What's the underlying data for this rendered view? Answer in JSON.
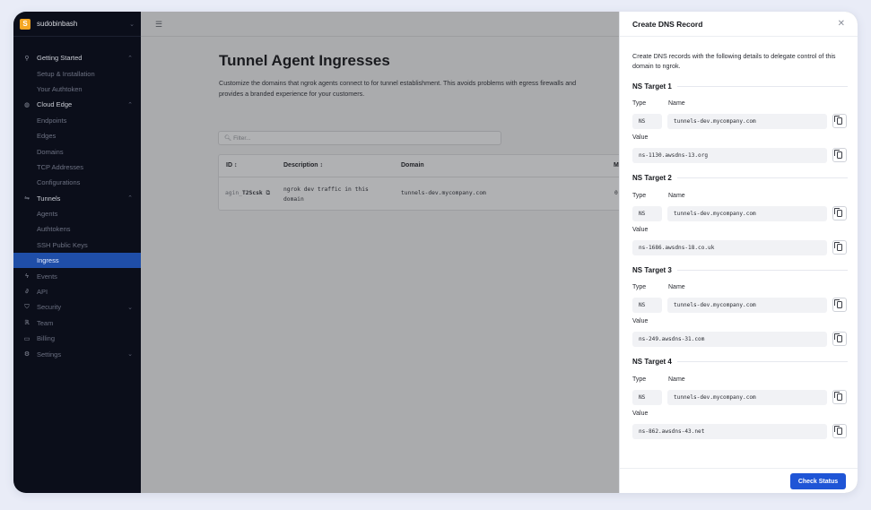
{
  "sidebar": {
    "org_initial": "S",
    "org_name": "sudobinbash",
    "items": [
      {
        "label": "Getting Started",
        "icon": "rocket-icon",
        "kind": "group"
      },
      {
        "label": "Setup & Installation",
        "kind": "sub"
      },
      {
        "label": "Your Authtoken",
        "kind": "sub"
      },
      {
        "label": "Cloud Edge",
        "icon": "globe-icon",
        "kind": "group"
      },
      {
        "label": "Endpoints",
        "kind": "sub"
      },
      {
        "label": "Edges",
        "kind": "sub"
      },
      {
        "label": "Domains",
        "kind": "sub"
      },
      {
        "label": "TCP Addresses",
        "kind": "sub"
      },
      {
        "label": "Configurations",
        "kind": "sub"
      },
      {
        "label": "Tunnels",
        "icon": "tunnel-icon",
        "kind": "group"
      },
      {
        "label": "Agents",
        "kind": "sub"
      },
      {
        "label": "Authtokens",
        "kind": "sub"
      },
      {
        "label": "SSH Public Keys",
        "kind": "sub"
      },
      {
        "label": "Ingress",
        "kind": "sub-active"
      },
      {
        "label": "Events",
        "icon": "bolt-icon",
        "kind": "item"
      },
      {
        "label": "API",
        "icon": "link-icon",
        "kind": "item"
      },
      {
        "label": "Security",
        "icon": "shield-icon",
        "kind": "item-chev"
      },
      {
        "label": "Team",
        "icon": "team-icon",
        "kind": "item"
      },
      {
        "label": "Billing",
        "icon": "card-icon",
        "kind": "item"
      },
      {
        "label": "Settings",
        "icon": "gear-icon",
        "kind": "item-chev"
      }
    ]
  },
  "main": {
    "title": "Tunnel Agent Ingresses",
    "description": "Customize the domains that ngrok agents connect to for tunnel establishment. This avoids problems with egress firewalls and provides a branded experience for your customers.",
    "filter_placeholder": "Filter...",
    "columns": [
      "ID ↕",
      "Description ↕",
      "Domain",
      "M"
    ],
    "row": {
      "id_prefix": "agin_",
      "id_suffix": "T2Scsk",
      "description": "ngrok dev traffic in this domain",
      "domain": "tunnels-dev.mycompany.com",
      "extra": "0"
    }
  },
  "panel": {
    "title": "Create DNS Record",
    "intro": "Create DNS records with the following details to delegate control of this domain to ngrok.",
    "type_label": "Type",
    "name_label": "Name",
    "value_label": "Value",
    "targets": [
      {
        "title": "NS Target 1",
        "type": "NS",
        "name": "tunnels-dev.mycompany.com",
        "value": "ns-1130.awsdns-13.org"
      },
      {
        "title": "NS Target 2",
        "type": "NS",
        "name": "tunnels-dev.mycompany.com",
        "value": "ns-1686.awsdns-18.co.uk"
      },
      {
        "title": "NS Target 3",
        "type": "NS",
        "name": "tunnels-dev.mycompany.com",
        "value": "ns-249.awsdns-31.com"
      },
      {
        "title": "NS Target 4",
        "type": "NS",
        "name": "tunnels-dev.mycompany.com",
        "value": "ns-862.awsdns-43.net"
      }
    ],
    "button": "Check Status"
  }
}
